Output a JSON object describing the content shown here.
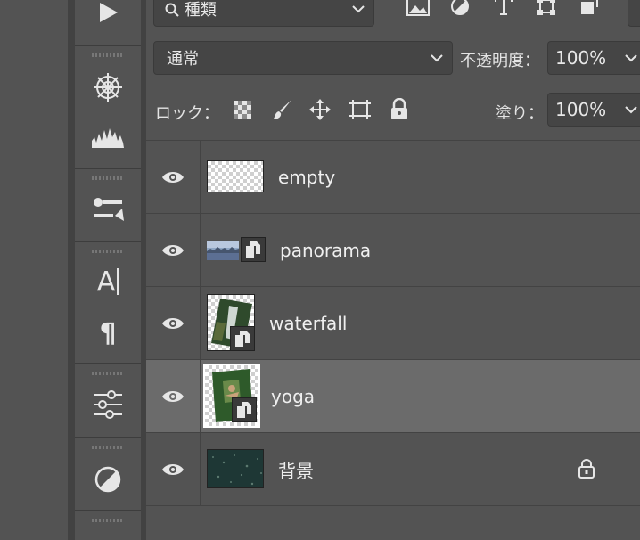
{
  "toolbar": {
    "tools": [
      "play-icon",
      "brush-settings-icon",
      "histogram-icon",
      "tool-presets-icon",
      "character-icon",
      "paragraph-icon",
      "adjustments-icon",
      "adjustment-circle-icon"
    ],
    "character_glyph": "A",
    "paragraph_glyph": "¶"
  },
  "filter": {
    "kind_label": "種類",
    "icons": [
      "image-filter-icon",
      "adjustment-filter-icon",
      "type-filter-icon",
      "shape-filter-icon",
      "smart-object-filter-icon"
    ]
  },
  "blend": {
    "mode": "通常",
    "opacity_label": "不透明度：",
    "opacity_value": "100%"
  },
  "lock": {
    "label": "ロック：",
    "icons": [
      "lock-transparent-icon",
      "lock-image-icon",
      "lock-position-icon",
      "lock-artboard-icon",
      "lock-all-icon"
    ],
    "fill_label": "塗り：",
    "fill_value": "100%"
  },
  "layers": [
    {
      "name": "empty",
      "visible": true,
      "thumb": "transparent",
      "smart_object": false,
      "selected": false,
      "locked": false
    },
    {
      "name": "panorama",
      "visible": true,
      "thumb": "panorama",
      "smart_object": true,
      "selected": false,
      "locked": false
    },
    {
      "name": "waterfall",
      "visible": true,
      "thumb": "waterfall",
      "smart_object": true,
      "selected": false,
      "locked": false
    },
    {
      "name": "yoga",
      "visible": true,
      "thumb": "yoga",
      "smart_object": true,
      "selected": true,
      "locked": false
    },
    {
      "name": "背景",
      "visible": true,
      "thumb": "background",
      "smart_object": false,
      "selected": false,
      "locked": true
    }
  ],
  "colors": {
    "panel_bg": "#535353",
    "selected_row": "#6b6b6b",
    "field_bg": "#454545"
  }
}
